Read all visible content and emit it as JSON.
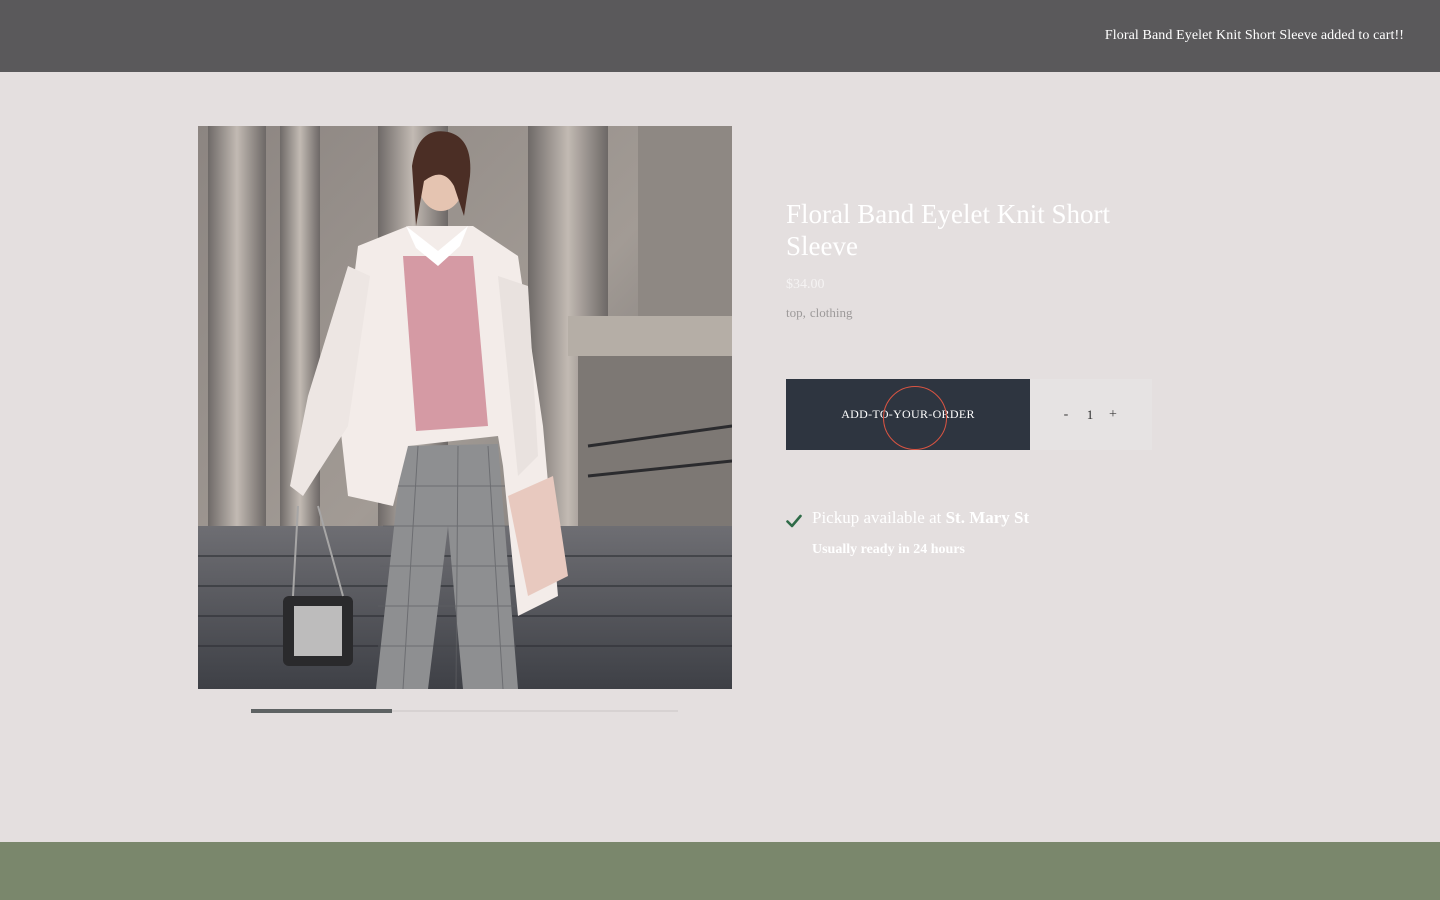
{
  "notification": {
    "message": "Floral Band Eyelet Knit Short Sleeve added to cart!!"
  },
  "header": {
    "logo_partial": "logo"
  },
  "product": {
    "title": "Floral Band Eyelet Knit Short Sleeve",
    "price": "$34.00",
    "tags": [
      "top,",
      "clothing"
    ],
    "image_icon": "product-photo-woman-white-coat",
    "gallery_progress": 0.33
  },
  "cart": {
    "add_label": "ADD-TO-YOUR-ORDER",
    "qty_minus": "-",
    "qty_value": "1",
    "qty_plus": "+"
  },
  "pickup": {
    "prefix": "Pickup available at ",
    "location": "St. Mary St",
    "eta": "Usually ready in 24 hours",
    "icon": "check-icon"
  },
  "colors": {
    "page_bg": "#e4dfdf",
    "toast_bg": "#5a595b",
    "button_bg": "#2e3540",
    "footer_bg": "#7a876c",
    "check": "#2f6b48",
    "cursor_ring": "#d95442"
  }
}
